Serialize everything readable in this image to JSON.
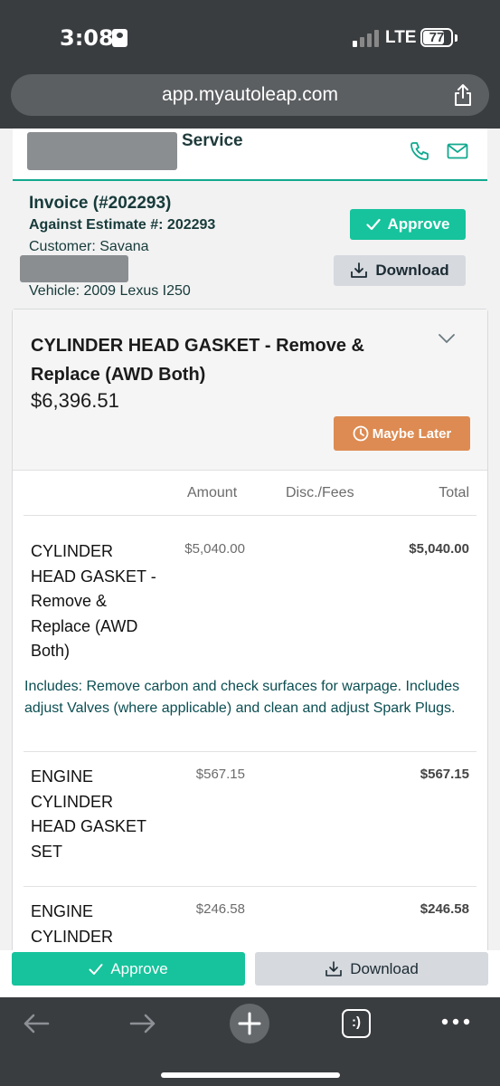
{
  "status_bar": {
    "time": "3:08",
    "network": "LTE",
    "battery": "77",
    "battery_level": 0.77
  },
  "browser": {
    "url": "app.myautoleap.com"
  },
  "shop": {
    "name_suffix": "Service"
  },
  "invoice": {
    "title": "Invoice (#202293)",
    "against_estimate": "Against Estimate #: 202293",
    "customer": "Customer: Savana",
    "vehicle": "Vehicle: 2009 Lexus I250",
    "approve_label": "Approve",
    "download_label": "Download"
  },
  "service": {
    "title": "CYLINDER HEAD GASKET - Remove & Replace (AWD Both)",
    "price": "$6,396.51",
    "maybe_later_label": "Maybe Later",
    "columns": [
      "Amount",
      "Disc./Fees",
      "Total"
    ],
    "items": [
      {
        "name": "CYLINDER HEAD GASKET - Remove & Replace (AWD Both)",
        "amount": "$5,040.00",
        "total": "$5,040.00",
        "description": "Includes: Remove carbon and check surfaces for warpage. Includes adjust Valves (where applicable) and clean and adjust Spark Plugs."
      },
      {
        "name": "ENGINE CYLINDER HEAD GASKET SET",
        "amount": "$567.15",
        "total": "$567.15"
      },
      {
        "name": "ENGINE CYLINDER",
        "amount": "$246.58",
        "total": "$246.58"
      }
    ]
  },
  "bottom_bar": {
    "approve_label": "Approve",
    "download_label": "Download"
  },
  "toolbar": {
    "tabs_label": ":)"
  },
  "colors": {
    "accent_green": "#16c39c",
    "maybe_later_orange": "#dd8b52",
    "chrome_dark": "#3a3d40"
  },
  "icons": [
    "id-card-icon",
    "signal-icon",
    "share-icon",
    "phone-icon",
    "mail-icon",
    "check-icon",
    "download-icon",
    "chevron-down-icon",
    "clock-icon",
    "back-arrow-icon",
    "forward-arrow-icon",
    "plus-icon",
    "tabs-icon",
    "more-icon"
  ]
}
